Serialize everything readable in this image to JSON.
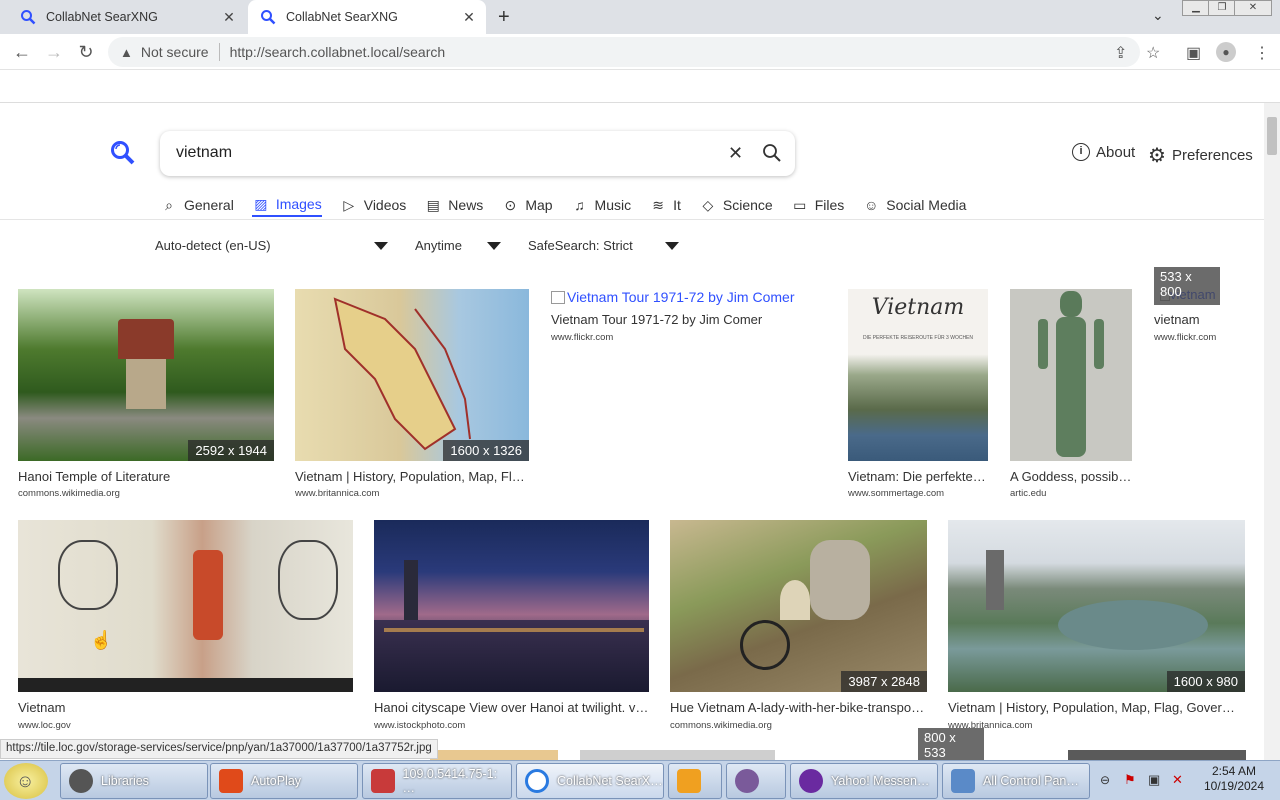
{
  "browser": {
    "tabs": [
      {
        "title": "CollabNet SearXNG",
        "active": false
      },
      {
        "title": "CollabNet SearXNG",
        "active": true
      }
    ],
    "security_label": "Not secure",
    "url": "http://search.collabnet.local/search"
  },
  "search": {
    "query": "vietnam",
    "about_label": "About",
    "preferences_label": "Preferences",
    "categories": [
      {
        "label": "General",
        "icon": "search-icon"
      },
      {
        "label": "Images",
        "icon": "image-icon",
        "active": true
      },
      {
        "label": "Videos",
        "icon": "play-icon"
      },
      {
        "label": "News",
        "icon": "newspaper-icon"
      },
      {
        "label": "Map",
        "icon": "map-pin-icon"
      },
      {
        "label": "Music",
        "icon": "music-icon"
      },
      {
        "label": "It",
        "icon": "layers-icon"
      },
      {
        "label": "Science",
        "icon": "graduation-cap-icon"
      },
      {
        "label": "Files",
        "icon": "files-icon"
      },
      {
        "label": "Social Media",
        "icon": "people-icon"
      }
    ],
    "filters": {
      "language": "Auto-detect (en-US)",
      "time": "Anytime",
      "safesearch": "SafeSearch: Strict"
    }
  },
  "results": [
    {
      "title": "Hanoi Temple of Literature",
      "source": "commons.wikimedia.org",
      "dimensions": "2592 x 1944"
    },
    {
      "title": "Vietnam | History, Population, Map, Fl…",
      "source": "www.britannica.com",
      "dimensions": "1600 x 1326"
    },
    {
      "title": "Vietnam Tour 1971-72 by Jim Comer",
      "source": "www.flickr.com",
      "alt": "Vietnam Tour 1971-72 by Jim Comer"
    },
    {
      "title": "Vietnam: Die perfekte…",
      "source": "www.sommertage.com",
      "image_text": "Vietnam",
      "image_subtext": "DIE PERFEKTE REISEROUTE FÜR 3 WOCHEN"
    },
    {
      "title": "A Goddess, possib…",
      "source": "artic.edu"
    },
    {
      "title": "vietnam",
      "source": "www.flickr.com",
      "dimensions": "533 x 800",
      "alt": "vietnam"
    },
    {
      "title": "Vietnam",
      "source": "www.loc.gov"
    },
    {
      "title": "Hanoi cityscape View over Hanoi at twilight. v…",
      "source": "www.istockphoto.com"
    },
    {
      "title": "Hue Vietnam A-lady-with-her-bike-transpo…",
      "source": "commons.wikimedia.org",
      "dimensions": "3987 x 2848"
    },
    {
      "title": "Vietnam | History, Population, Map, Flag, Gover…",
      "source": "www.britannica.com",
      "dimensions": "1600 x 980"
    },
    {
      "dimensions": "800 x 533"
    }
  ],
  "status_url": "https://tile.loc.gov/storage-services/service/pnp/yan/1a37000/1a37700/1a37752r.jpg",
  "taskbar": {
    "items": [
      "Libraries",
      "AutoPlay",
      "109.0.5414.75-1: …",
      "CollabNet SearX…",
      "Yahoo! Messen…",
      "All Control Pan…"
    ],
    "time": "2:54 AM",
    "date": "10/19/2024"
  },
  "colors": {
    "accent": "#3050ff",
    "tabstrip": "#dee1e6",
    "taskbar": "#c5d4e8"
  }
}
